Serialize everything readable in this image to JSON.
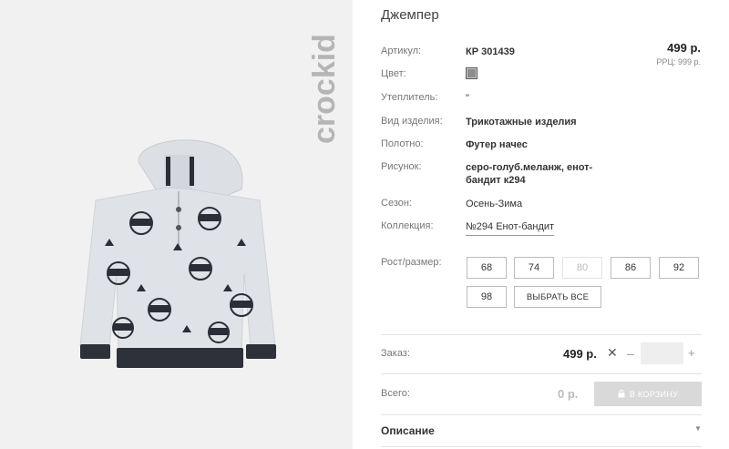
{
  "logo_text": "crockid",
  "product": {
    "title": "Джемпер",
    "price": "499 р.",
    "rrp": "РРЦ: 999 р."
  },
  "attributes": {
    "article": {
      "label": "Артикул:",
      "value": "КР 301439"
    },
    "color": {
      "label": "Цвет:",
      "swatch": "#8d8d8d"
    },
    "insulation": {
      "label": "Утеплитель:",
      "value": "\""
    },
    "type": {
      "label": "Вид изделия:",
      "value": "Трикотажные изделия"
    },
    "fabric": {
      "label": "Полотно:",
      "value": "Футер начес"
    },
    "print": {
      "label": "Рисунок:",
      "value": "серо-голуб.меланж, енот-бандит к294"
    },
    "season": {
      "label": "Сезон:",
      "value": "Осень-Зима"
    },
    "collection": {
      "label": "Коллекция:",
      "value": "№294 Енот-бандит"
    }
  },
  "sizes": {
    "label": "Рост/размер:",
    "options": [
      "68",
      "74",
      "80",
      "86",
      "92",
      "98"
    ],
    "select_all": "ВЫБРАТЬ ВСЕ"
  },
  "order": {
    "label": "Заказ:",
    "price": "499 р.",
    "times": "✕",
    "minus": "–",
    "plus": "+",
    "qty": ""
  },
  "total": {
    "label": "Всего:",
    "value": "0 р.",
    "cart_button": "В КОРЗИНУ"
  },
  "description": {
    "label": "Описание",
    "arrow": "▼"
  }
}
